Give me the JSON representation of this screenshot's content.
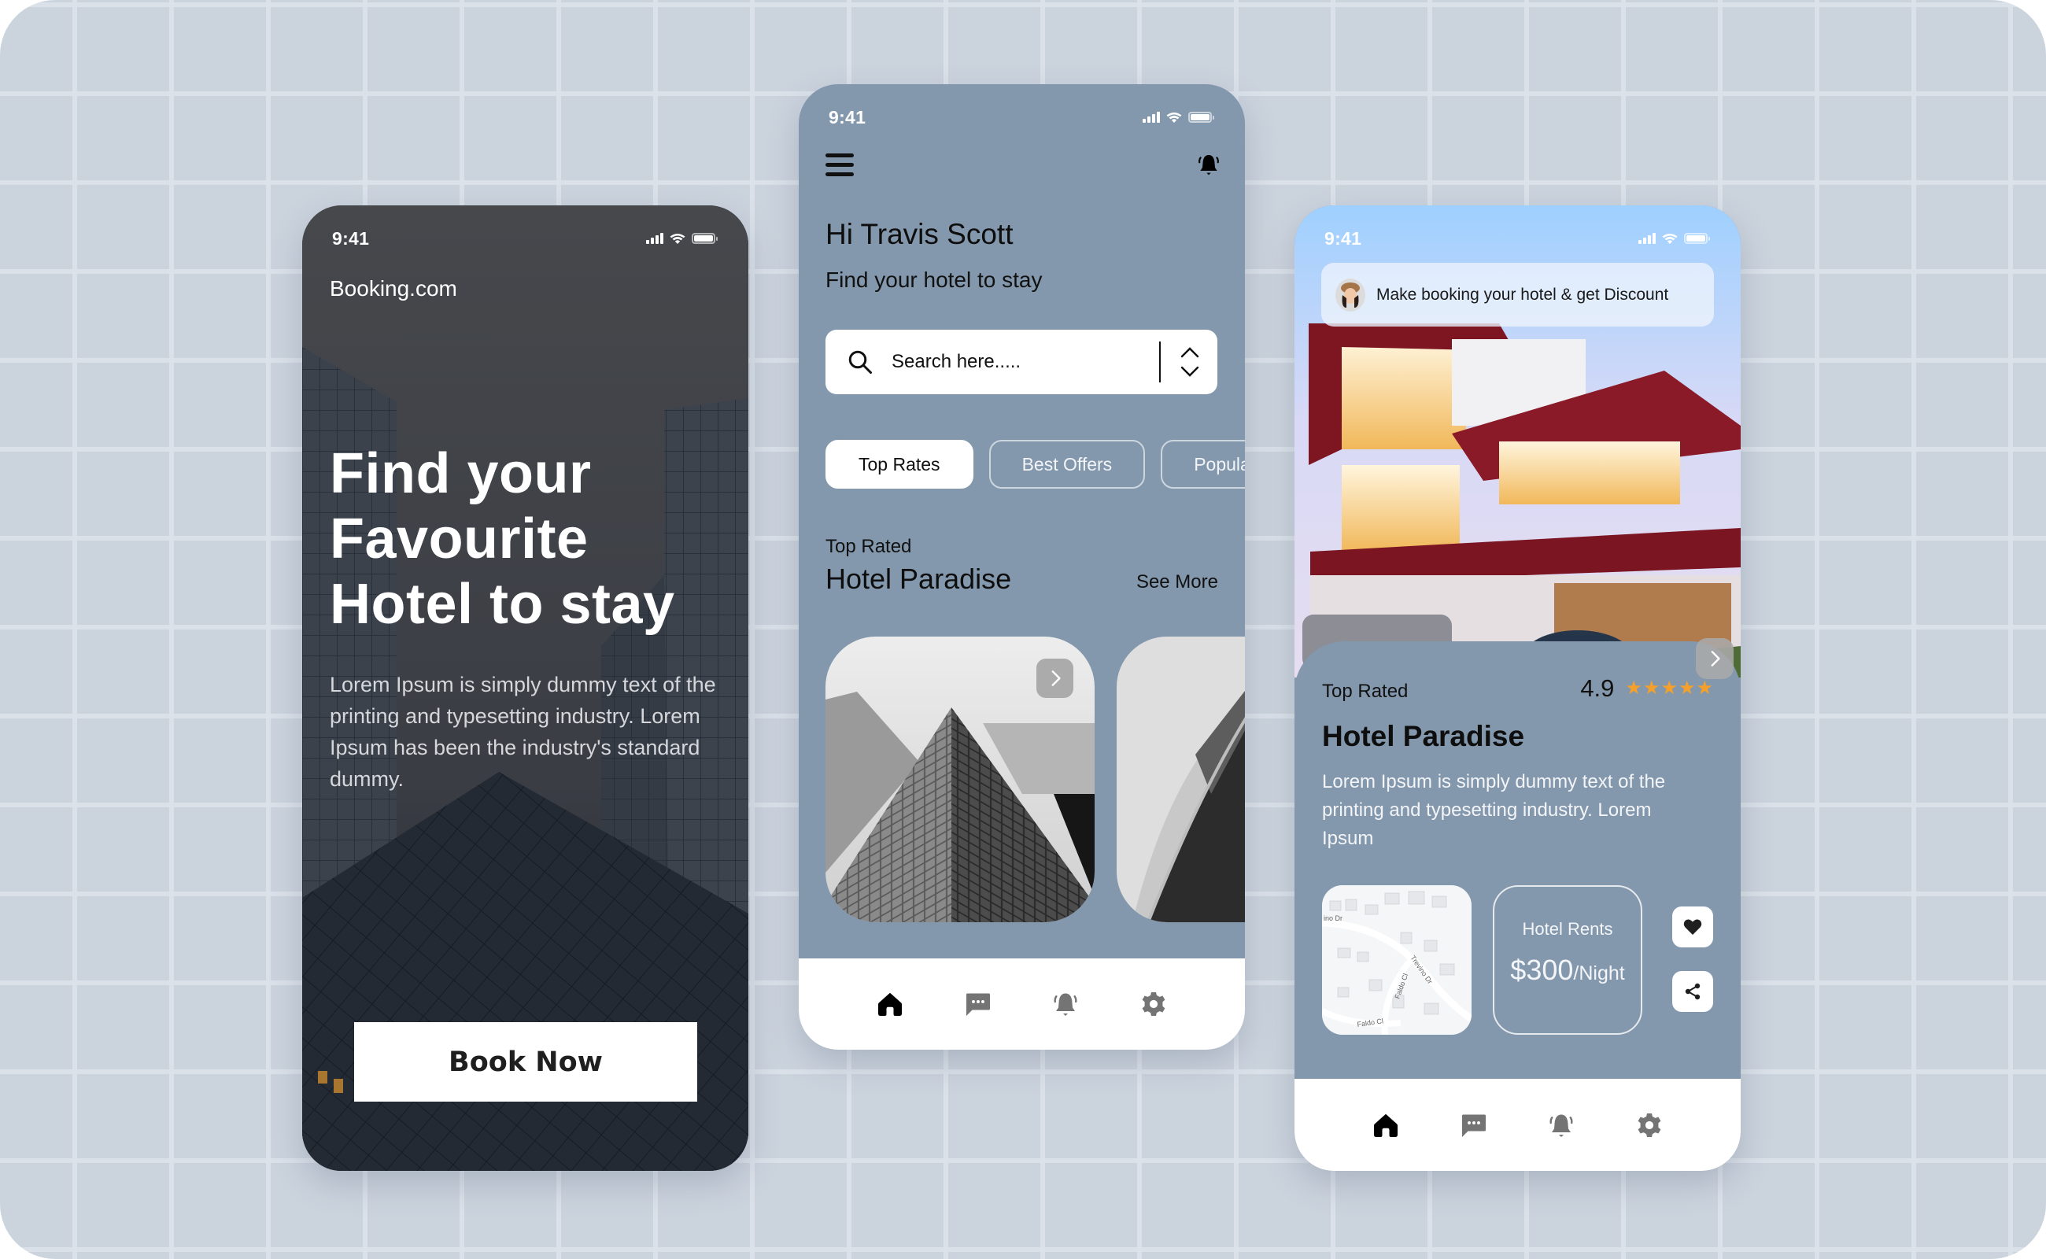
{
  "colors": {
    "background": "#cbd3dd",
    "phone_dark": "#46484c",
    "phone_slate": "#8398ad",
    "star": "#f5a02a",
    "nav_active": "#000000",
    "nav_inactive": "#747474"
  },
  "status_bar": {
    "time": "9:41"
  },
  "onboarding": {
    "brand": "Booking.com",
    "title_lines": [
      "Find your",
      "Favourite",
      "Hotel to stay"
    ],
    "description": "Lorem Ipsum is simply dummy text of the printing and typesetting industry. Lorem Ipsum has been the industry's standard dummy.",
    "cta_label": "Book Now"
  },
  "home": {
    "menu_icon": "hamburger-icon",
    "notification_icon": "bell-icon",
    "greeting": "Hi Travis Scott",
    "subtitle": "Find your hotel to stay",
    "search": {
      "placeholder": "Search here.....",
      "value": ""
    },
    "chips": [
      {
        "label": "Top Rates",
        "active": true
      },
      {
        "label": "Best Offers",
        "active": false
      },
      {
        "label": "Popular",
        "active": false
      }
    ],
    "section_kicker": "Top Rated",
    "section_title": "Hotel Paradise",
    "see_more": "See More",
    "cards": [
      {
        "image": "glass-skyscraper-photo"
      },
      {
        "image": "curved-building-photo"
      }
    ]
  },
  "detail": {
    "promo": "Make booking your hotel & get Discount",
    "kicker": "Top Rated",
    "rating": "4.9",
    "stars": 5,
    "stars_max": 5,
    "hotel_name": "Hotel Paradise",
    "description": "Lorem Ipsum is simply dummy text of the printing and typesetting industry. Lorem Ipsum",
    "map_labels": [
      "Trevino Dr",
      "Faldo Cl",
      "Faldo Cl",
      "ino Dr"
    ],
    "rent_label": "Hotel Rents",
    "rent_amount": "$300",
    "rent_unit": "/Night"
  },
  "bottom_nav": [
    {
      "name": "home",
      "icon": "home-icon",
      "active": true
    },
    {
      "name": "messages",
      "icon": "chat-icon",
      "active": false
    },
    {
      "name": "notifications",
      "icon": "bell-icon",
      "active": false
    },
    {
      "name": "settings",
      "icon": "gear-icon",
      "active": false
    }
  ]
}
